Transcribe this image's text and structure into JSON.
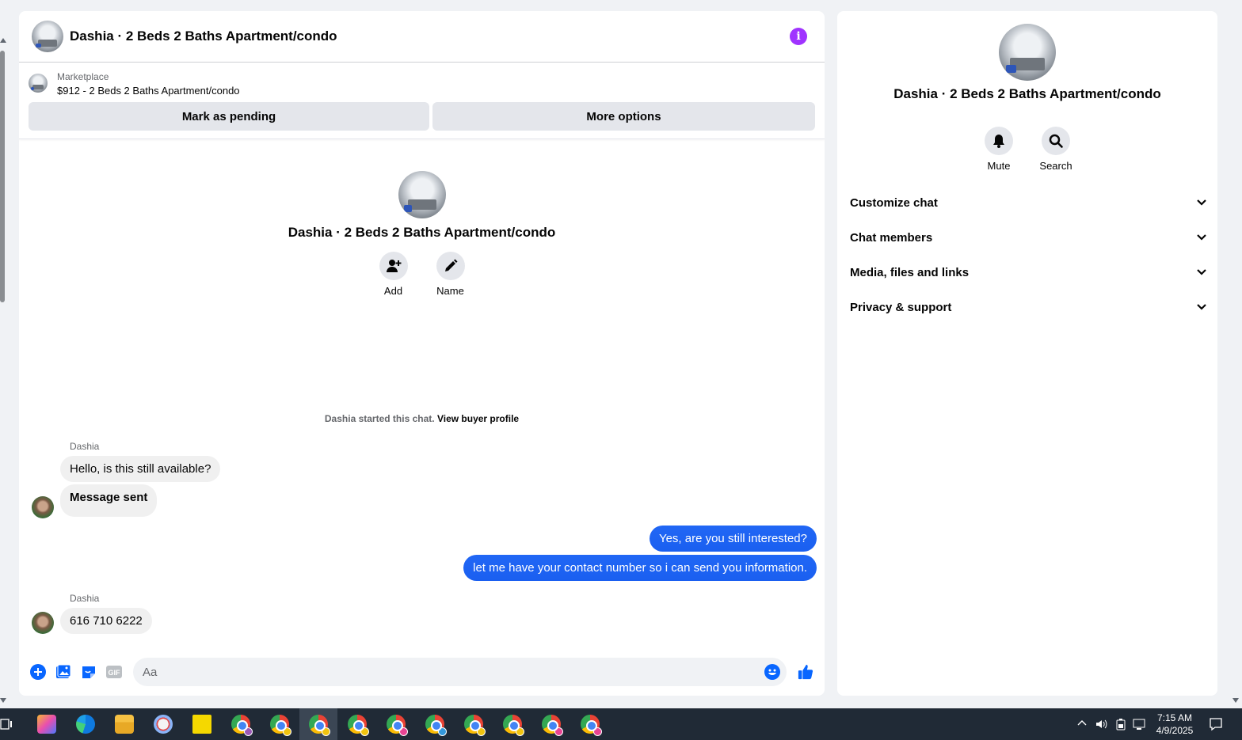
{
  "chat": {
    "title": "Dashia · 2 Beds 2 Baths Apartment/condo",
    "listing": {
      "source": "Marketplace",
      "title": "$912 - 2 Beds 2 Baths Apartment/condo"
    },
    "buttons": {
      "mark_pending": "Mark as pending",
      "more_options": "More options"
    },
    "intro": {
      "title": "Dashia · 2 Beds 2 Baths Apartment/condo",
      "add_label": "Add",
      "name_label": "Name"
    },
    "started": {
      "text": "Dashia started this chat.",
      "link": "View buyer profile"
    },
    "messages": [
      {
        "sender": "Dashia",
        "text": "Hello, is this still available?"
      },
      {
        "sender": "",
        "text": "Message sent"
      },
      {
        "sender": "me",
        "text": "Yes, are you still interested?"
      },
      {
        "sender": "me",
        "text": "let me have your contact number so i can send you information."
      },
      {
        "sender": "Dashia",
        "text": "616 710 6222"
      }
    ],
    "composer": {
      "placeholder": "Aa"
    }
  },
  "info_panel": {
    "title": "Dashia · 2 Beds 2 Baths Apartment/condo",
    "mute_label": "Mute",
    "search_label": "Search",
    "sections": [
      "Customize chat",
      "Chat members",
      "Media, files and links",
      "Privacy & support"
    ]
  },
  "taskbar": {
    "time": "7:15 AM",
    "date": "4/9/2025"
  },
  "colors": {
    "accent": "#0866ff",
    "outgoing_bubble": "#1f63f2",
    "info_icon": "#a033ff"
  }
}
